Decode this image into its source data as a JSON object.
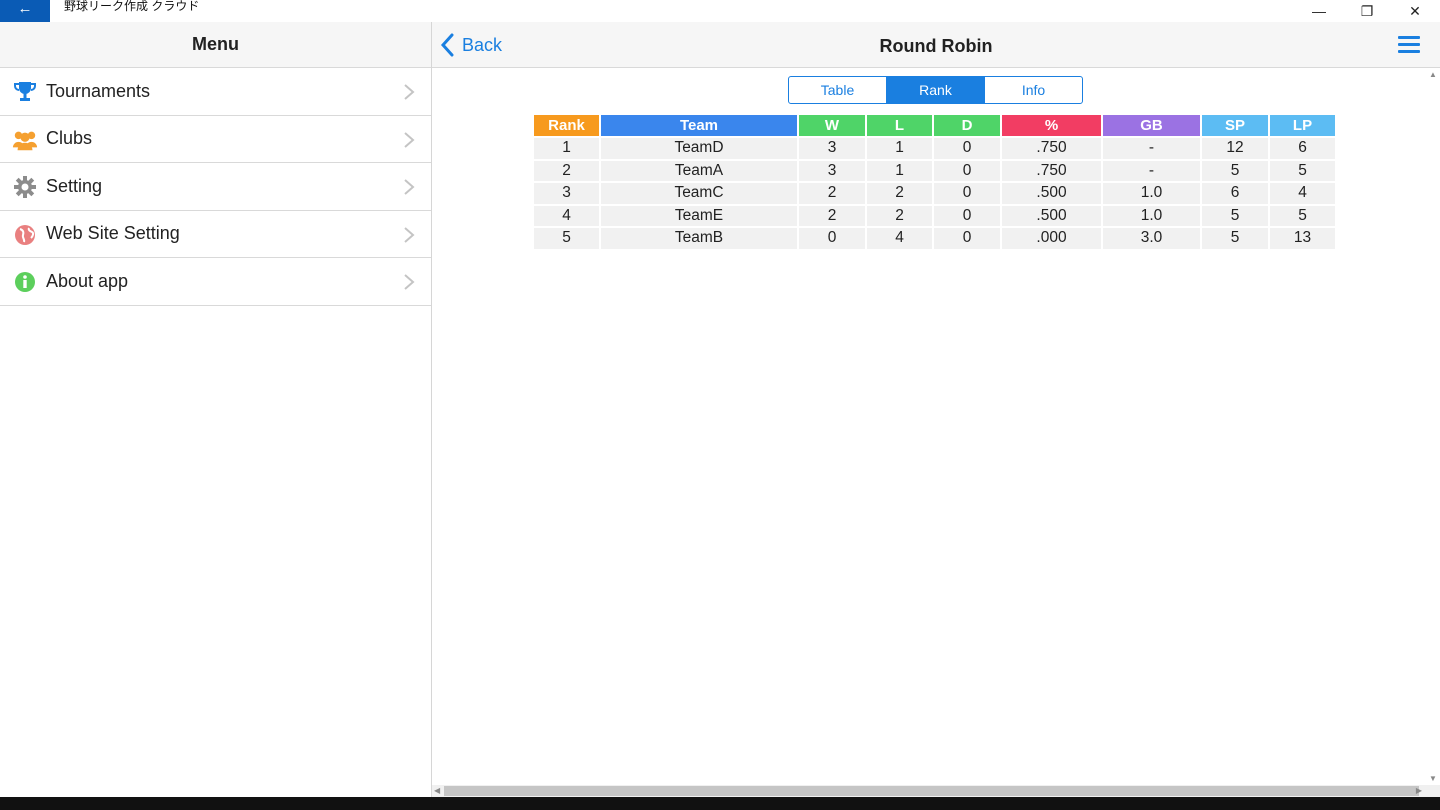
{
  "window": {
    "title": "野球リーク作成 クラウド",
    "back_glyph": "←",
    "minimize_glyph": "—",
    "maximize_glyph": "❐",
    "close_glyph": "✕"
  },
  "sidebar": {
    "title": "Menu",
    "items": [
      {
        "label": "Tournaments",
        "icon": "trophy-icon",
        "color": "#1a7fe0"
      },
      {
        "label": "Clubs",
        "icon": "group-icon",
        "color": "#f5a030"
      },
      {
        "label": "Setting",
        "icon": "gear-icon",
        "color": "#8c8c8c"
      },
      {
        "label": "Web Site Setting",
        "icon": "globe-icon",
        "color": "#e98080"
      },
      {
        "label": "About app",
        "icon": "info-icon",
        "color": "#5ccf5c"
      }
    ]
  },
  "header": {
    "back_label": "Back",
    "title": "Round Robin"
  },
  "tabs": [
    {
      "label": "Table",
      "active": false
    },
    {
      "label": "Rank",
      "active": true
    },
    {
      "label": "Info",
      "active": false
    }
  ],
  "rank_table": {
    "columns": [
      {
        "label": "Rank",
        "color": "#f79a1e",
        "width": 65
      },
      {
        "label": "Team",
        "color": "#3a86ed",
        "width": 196
      },
      {
        "label": "W",
        "color": "#4fd468",
        "width": 66
      },
      {
        "label": "L",
        "color": "#4fd468",
        "width": 65
      },
      {
        "label": "D",
        "color": "#4fd468",
        "width": 66
      },
      {
        "label": "%",
        "color": "#f23d63",
        "width": 99
      },
      {
        "label": "GB",
        "color": "#9b72e3",
        "width": 97
      },
      {
        "label": "SP",
        "color": "#5cbcf3",
        "width": 66
      },
      {
        "label": "LP",
        "color": "#5cbcf3",
        "width": 65
      }
    ],
    "rows": [
      [
        "1",
        "TeamD",
        "3",
        "1",
        "0",
        ".750",
        "-",
        "12",
        "6"
      ],
      [
        "2",
        "TeamA",
        "3",
        "1",
        "0",
        ".750",
        "-",
        "5",
        "5"
      ],
      [
        "3",
        "TeamC",
        "2",
        "2",
        "0",
        ".500",
        "1.0",
        "6",
        "4"
      ],
      [
        "4",
        "TeamE",
        "2",
        "2",
        "0",
        ".500",
        "1.0",
        "5",
        "5"
      ],
      [
        "5",
        "TeamB",
        "0",
        "4",
        "0",
        ".000",
        "3.0",
        "5",
        "13"
      ]
    ]
  }
}
